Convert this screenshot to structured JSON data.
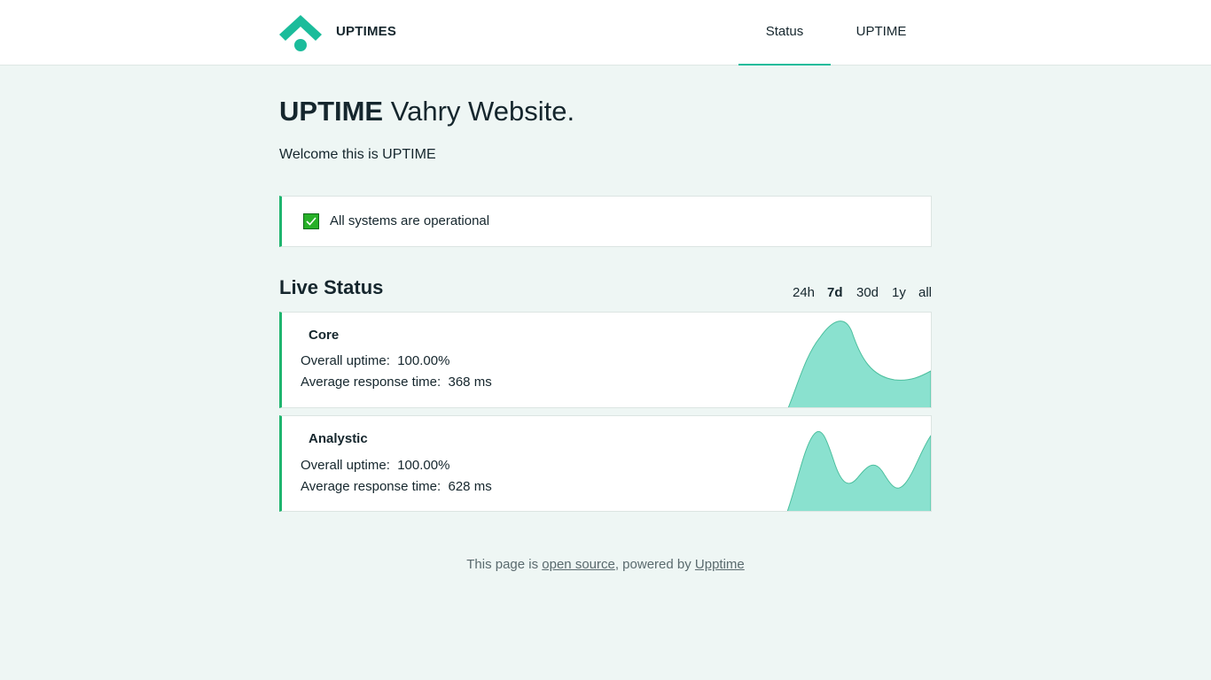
{
  "header": {
    "brand": "UPTIMES",
    "nav": [
      {
        "label": "Status",
        "active": true
      },
      {
        "label": "UPTIME",
        "active": false
      }
    ],
    "accent_color": "#1bbc9b"
  },
  "hero": {
    "title_bold": "UPTIME",
    "title_rest": " Vahry Website.",
    "intro": "Welcome this is UPTIME"
  },
  "summary": {
    "icon": "check-icon",
    "text": "All systems are operational",
    "status_color": "#1fb56f"
  },
  "live": {
    "title": "Live Status",
    "ranges": [
      "24h",
      "7d",
      "30d",
      "1y",
      "all"
    ],
    "active_range": "7d"
  },
  "services": [
    {
      "name": "Core",
      "uptime_label": "Overall uptime:",
      "uptime_value": "100.00%",
      "response_label": "Average response time:",
      "response_value": "368 ms"
    },
    {
      "name": "Analystic",
      "uptime_label": "Overall uptime:",
      "uptime_value": "100.00%",
      "response_label": "Average response time:",
      "response_value": "628 ms"
    }
  ],
  "footer": {
    "prefix": "This page is ",
    "link1": "open source",
    "middle": ", powered by ",
    "link2": "Upptime"
  }
}
